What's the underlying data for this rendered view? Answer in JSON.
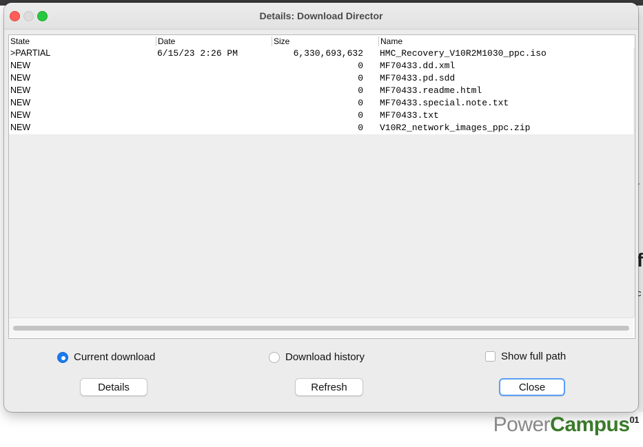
{
  "background": {
    "right_text_big": "f",
    "right_text_small": "c",
    "right_text_tiny": "r"
  },
  "window": {
    "title": "Details: Download Director"
  },
  "table": {
    "headers": [
      "State",
      "Date",
      "Size",
      "Name"
    ],
    "rows": [
      {
        "state": ">PARTIAL",
        "date": "6/15/23 2:26 PM",
        "size": "6,330,693,632",
        "name": "HMC_Recovery_V10R2M1030_ppc.iso"
      },
      {
        "state": "NEW",
        "date": "",
        "size": "0",
        "name": "MF70433.dd.xml"
      },
      {
        "state": "NEW",
        "date": "",
        "size": "0",
        "name": "MF70433.pd.sdd"
      },
      {
        "state": "NEW",
        "date": "",
        "size": "0",
        "name": "MF70433.readme.html"
      },
      {
        "state": "NEW",
        "date": "",
        "size": "0",
        "name": "MF70433.special.note.txt"
      },
      {
        "state": "NEW",
        "date": "",
        "size": "0",
        "name": "MF70433.txt"
      },
      {
        "state": "NEW",
        "date": "",
        "size": "0",
        "name": "V10R2_network_images_ppc.zip"
      }
    ]
  },
  "controls": {
    "radio_current_label": "Current download",
    "radio_current_selected": true,
    "radio_history_label": "Download history",
    "radio_history_selected": false,
    "show_full_path_label": "Show full path",
    "show_full_path_checked": false,
    "details_button": "Details",
    "refresh_button": "Refresh",
    "close_button": "Close"
  },
  "logo": {
    "part1": "Power",
    "part2": "Campus",
    "superscript": "01"
  },
  "colors": {
    "accent": "#1a7bf2",
    "close_traffic": "#ff5f57",
    "max_traffic": "#28c840",
    "logo_green": "#3a7a2a",
    "logo_gray": "#888888"
  }
}
